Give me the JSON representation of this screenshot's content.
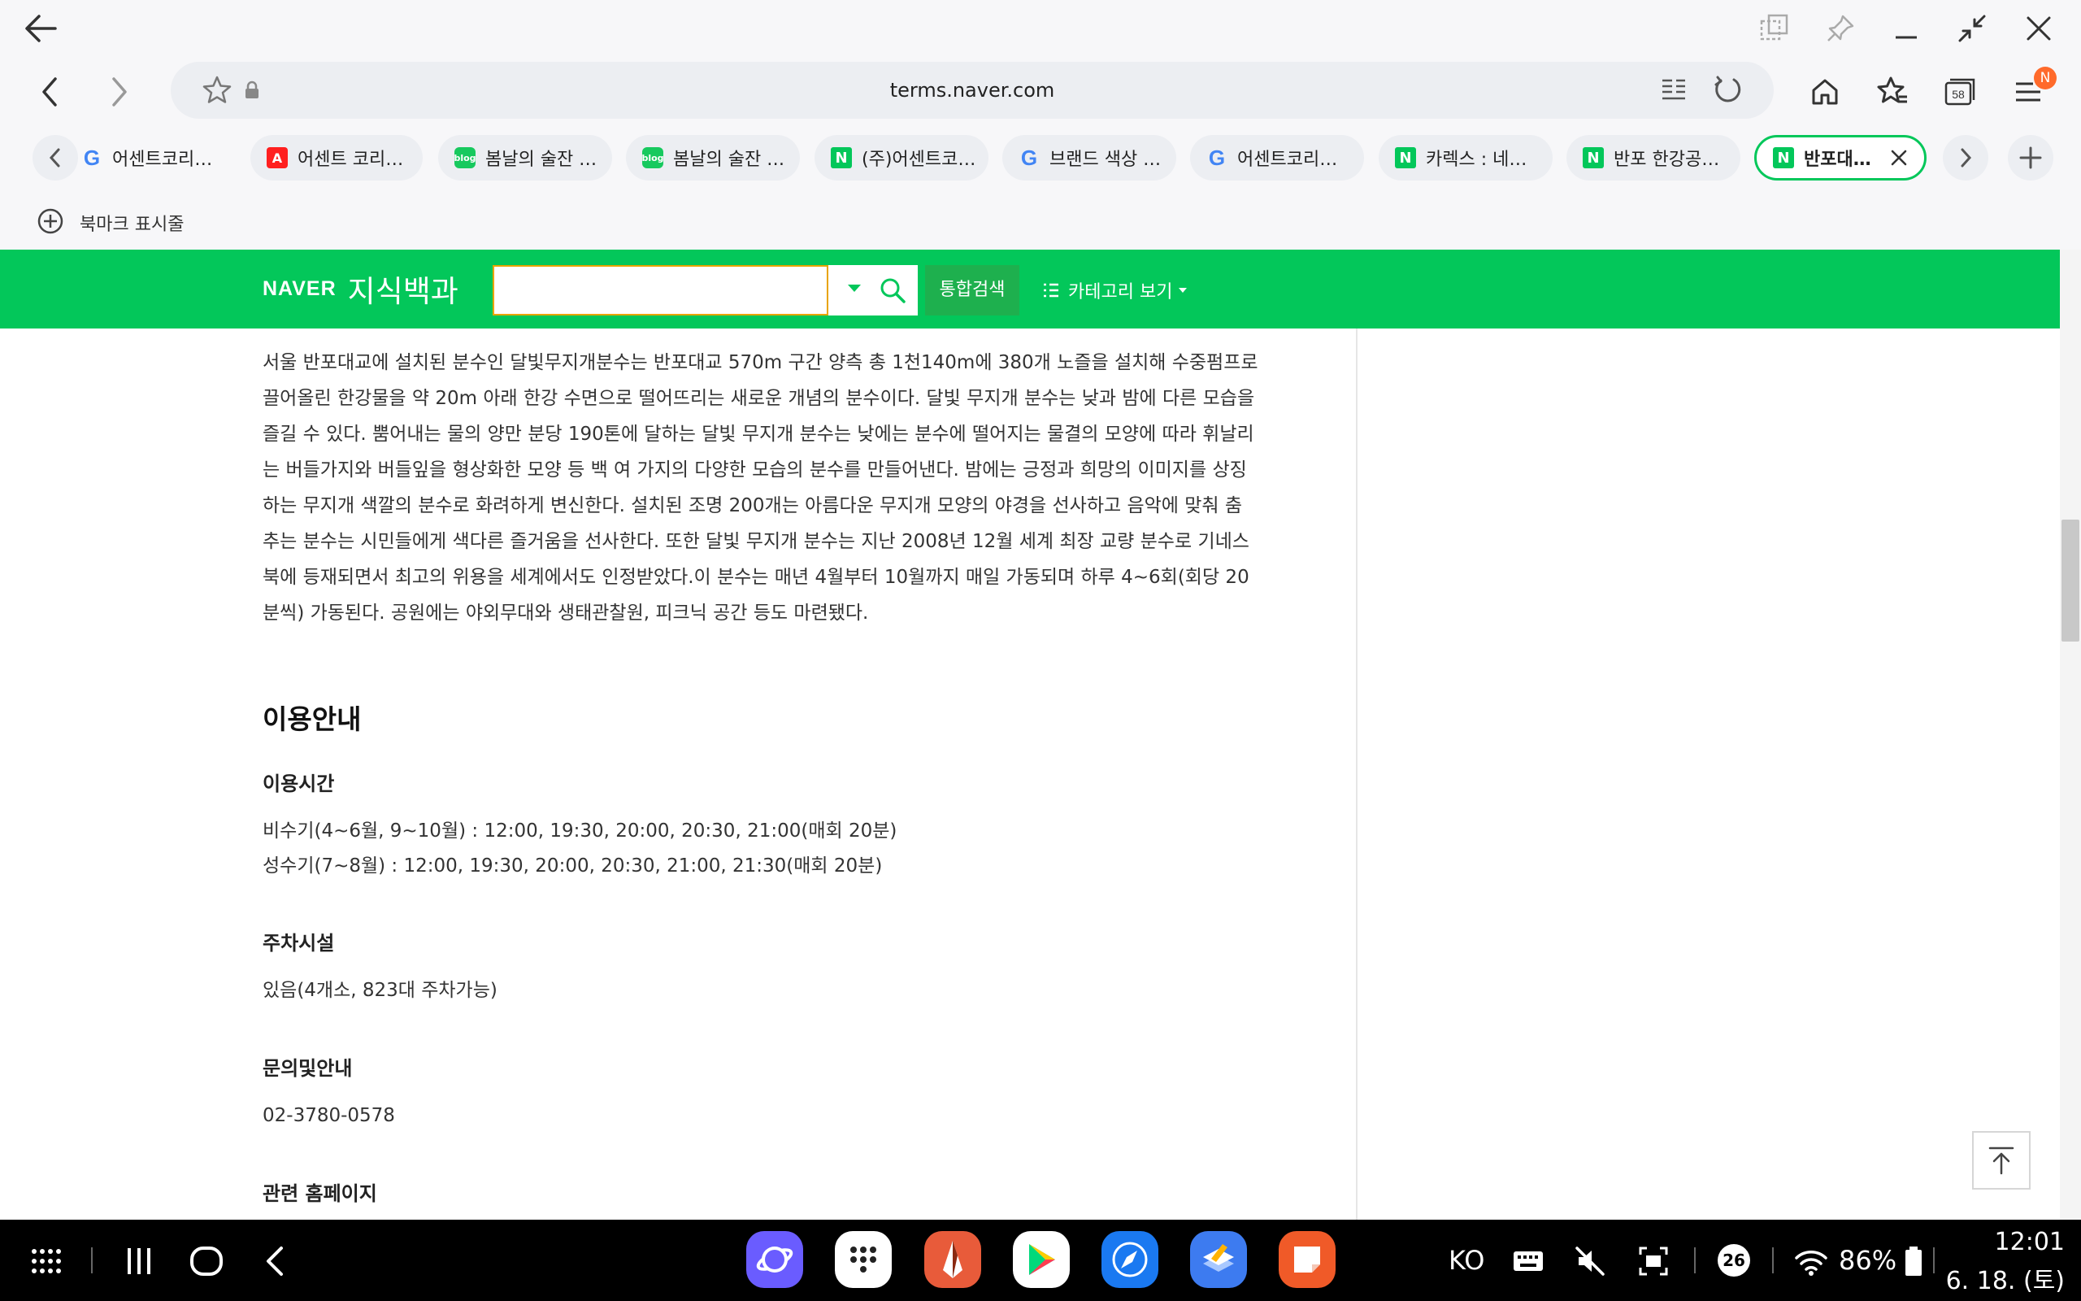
{
  "browser": {
    "url": "terms.naver.com",
    "tab_count_icon": "58",
    "menu_badge": "N",
    "tabs": [
      {
        "label": "어센트코리…",
        "favicon": "G"
      },
      {
        "label": "어센트 코리…",
        "favicon": "A"
      },
      {
        "label": "봄날의 술잔 …",
        "favicon": "blog"
      },
      {
        "label": "봄날의 술잔 …",
        "favicon": "blog"
      },
      {
        "label": "(주)어센트코…",
        "favicon": "N"
      },
      {
        "label": "브랜드 색상 …",
        "favicon": "G"
      },
      {
        "label": "어센트코리…",
        "favicon": "G"
      },
      {
        "label": "카렉스 : 네…",
        "favicon": "N"
      },
      {
        "label": "반포 한강공…",
        "favicon": "N"
      },
      {
        "label": "반포대…",
        "favicon": "N"
      }
    ],
    "bookmark_bar_label": "북마크 표시줄"
  },
  "naver": {
    "brand": "NAVER",
    "service": "지식백과",
    "search_value": "",
    "unified_search": "통합검색",
    "category_view": "카테고리 보기"
  },
  "article": {
    "body": "서울 반포대교에 설치된 분수인 달빛무지개분수는 반포대교 570m 구간 양측 총 1천140m에 380개 노즐을 설치해 수중펌프로 끌어올린 한강물을 약 20m 아래 한강 수면으로 떨어뜨리는 새로운 개념의 분수이다. 달빛 무지개 분수는 낮과 밤에 다른 모습을 즐길 수 있다. 뿜어내는 물의 양만 분당 190톤에 달하는 달빛 무지개 분수는 낮에는 분수에 떨어지는 물결의 모양에 따라 휘날리는 버들가지와 버들잎을 형상화한 모양 등 백 여 가지의 다양한 모습의 분수를 만들어낸다. 밤에는 긍정과 희망의 이미지를 상징하는 무지개 색깔의 분수로 화려하게 변신한다. 설치된 조명 200개는 아름다운 무지개 모양의 야경을 선사하고 음악에 맞춰 춤추는 분수는 시민들에게 색다른 즐거움을 선사한다. 또한 달빛 무지개 분수는 지난 2008년 12월 세계 최장 교량 분수로 기네스북에 등재되면서 최고의 위용을 세계에서도 인정받았다.이 분수는 매년 4월부터 10월까지 매일 가동되며 하루 4~6회(회당 20분씩) 가동된다. 공원에는 야외무대와 생태관찰원, 피크닉 공간 등도 마련됐다.",
    "section_title": "이용안내",
    "hours_title": "이용시간",
    "hours_offpeak": "비수기(4~6월, 9~10월) : 12:00, 19:30, 20:00, 20:30, 21:00(매회 20분)",
    "hours_peak": "성수기(7~8월) : 12:00, 19:30, 20:00, 20:30, 21:00, 21:30(매회 20분)",
    "parking_title": "주차시설",
    "parking_text": "있음(4개소, 823대 주차가능)",
    "contact_title": "문의및안내",
    "contact_text": "02-3780-0578",
    "homepage_title": "관련 홈페이지"
  },
  "taskbar": {
    "lang": "KO",
    "notif_count": "26",
    "battery": "86%",
    "time": "12:01",
    "date": "6. 18. (토)"
  },
  "colors": {
    "naver_green": "#03c75a",
    "active_tab_border": "#03c75a",
    "search_border": "#e8a400",
    "badge": "#ff6a2b"
  }
}
